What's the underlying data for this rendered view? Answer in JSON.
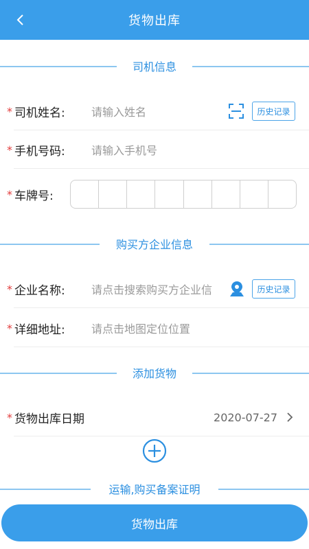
{
  "header": {
    "title": "货物出库"
  },
  "driver_section": {
    "title": "司机信息",
    "name": {
      "label": "司机姓名:",
      "placeholder": "请输入姓名",
      "history": "历史记录"
    },
    "phone": {
      "label": "手机号码:",
      "placeholder": "请输入手机号"
    },
    "plate": {
      "label": "车牌号:"
    }
  },
  "buyer_section": {
    "title": "购买方企业信息",
    "company": {
      "label": "企业名称:",
      "placeholder": "请点击搜索购买方企业信",
      "history": "历史记录"
    },
    "address": {
      "label": "详细地址:",
      "placeholder": "请点击地图定位位置"
    }
  },
  "goods_section": {
    "title": "添加货物",
    "date": {
      "label": "货物出库日期",
      "value": "2020-07-27"
    }
  },
  "proof_section": {
    "title": "运输,购买备案证明"
  },
  "submit": {
    "label": "货物出库"
  },
  "colors": {
    "primary": "#3a9eea",
    "accent_text": "#2b8fe0",
    "required": "#e23c3c"
  }
}
